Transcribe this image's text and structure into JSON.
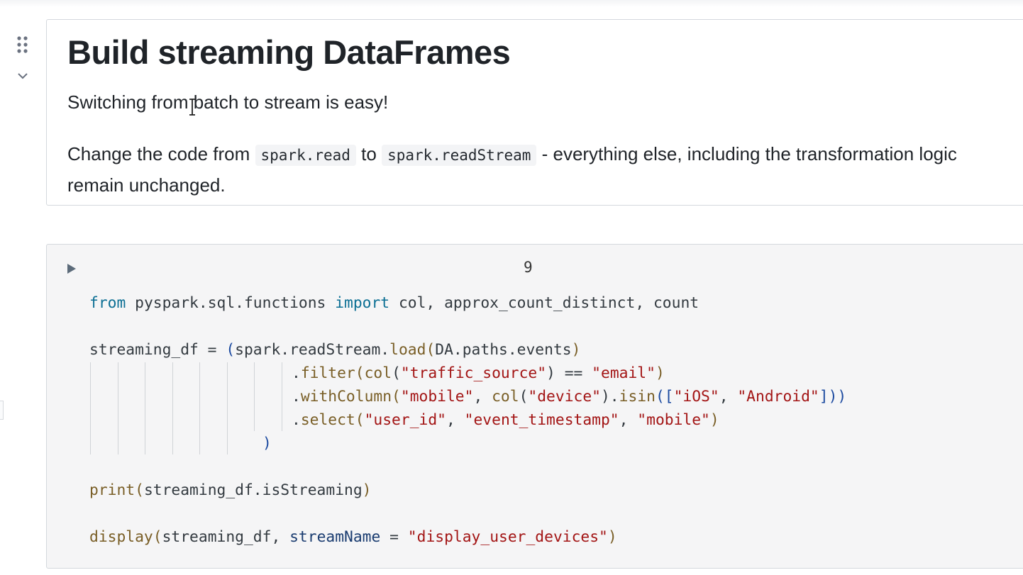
{
  "markdown_cell": {
    "title": "Build streaming DataFrames",
    "para1": "Switching from batch to stream is easy!",
    "para2_prefix": "Change the code from ",
    "code_a": "spark.read",
    "para2_mid": " to ",
    "code_b": "spark.readStream",
    "para2_suffix": " - everything else, including the transformation logic remain unchanged."
  },
  "code_cell": {
    "cell_number": "9",
    "line1": {
      "kw_from": "from",
      "module": " pyspark.sql.functions ",
      "kw_import": "import",
      "names": " col, approx_count_distinct, count"
    },
    "line2": {
      "var": "streaming_df = ",
      "open": "(",
      "obj": "spark.readStream.",
      "fn": "load",
      "args_open": "(",
      "arg": "DA.paths.events",
      "args_close": ")"
    },
    "line3": {
      "dot": ".",
      "fn": "filter",
      "open": "(",
      "col_fn": "col",
      "col_open": "(",
      "str": "\"traffic_source\"",
      "col_close": ")",
      "op": " == ",
      "str2": "\"email\"",
      "close": ")"
    },
    "line4": {
      "dot": ".",
      "fn": "withColumn",
      "open": "(",
      "str": "\"mobile\"",
      "comma": ", ",
      "col_fn": "col",
      "col_open": "(",
      "str2": "\"device\"",
      "col_close": ").",
      "isin": "isin",
      "isin_open": "([",
      "str3": "\"iOS\"",
      "comma2": ", ",
      "str4": "\"Android\"",
      "close": "]))"
    },
    "line5": {
      "dot": ".",
      "fn": "select",
      "open": "(",
      "str": "\"user_id\"",
      "comma": ", ",
      "str2": "\"event_timestamp\"",
      "comma2": ", ",
      "str3": "\"mobile\"",
      "close": ")"
    },
    "line6": {
      "close": ")"
    },
    "line7": {
      "fn": "print",
      "open": "(",
      "arg": "streaming_df.isStreaming",
      "close": ")"
    },
    "line8": {
      "fn": "display",
      "open": "(",
      "arg": "streaming_df, ",
      "param": "streamName",
      "eq": " = ",
      "str": "\"display_user_devices\"",
      "close": ")"
    }
  },
  "icons": {
    "drag": "drag-dots-icon",
    "collapse": "chevron-down-icon",
    "run": "play-icon",
    "cursor": "text-cursor-icon"
  },
  "colors": {
    "keyword": "#0c6f94",
    "function": "#795e26",
    "string": "#a31515",
    "code_bg": "#f5f5f6"
  }
}
